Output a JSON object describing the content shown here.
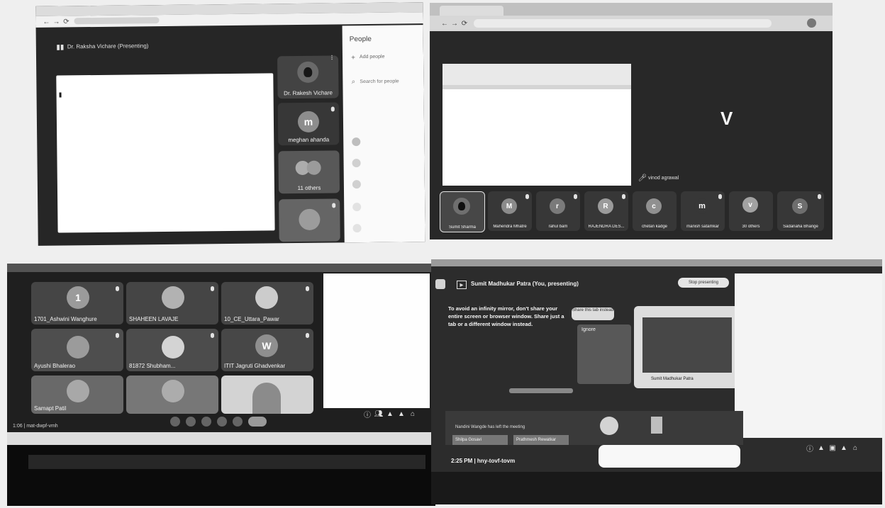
{
  "panel1": {
    "header_title": "Dr. Raksha Vichare (Presenting)",
    "presenter_name": "Dr. Rakesh Vichare",
    "participant_m_initial": "m",
    "participant_m_name": "meghan ahanda",
    "others_label": "11 others",
    "people_title": "People",
    "add_people_label": "Add people",
    "search_placeholder": "Search for people"
  },
  "panel2": {
    "large_tile_initial": "V",
    "large_tile_name": "vinod agrawal",
    "participants": [
      {
        "initial": "",
        "name": "Sumit Sharma"
      },
      {
        "initial": "M",
        "name": "Mahendra Mhatre"
      },
      {
        "initial": "r",
        "name": "rahul bam"
      },
      {
        "initial": "R",
        "name": "RAJENDRA DES..."
      },
      {
        "initial": "c",
        "name": "chetan kadge"
      },
      {
        "initial": "m",
        "name": "manish satamkar"
      },
      {
        "initial": "v",
        "name": "30 others"
      },
      {
        "initial": "S",
        "name": "Sadanaha Bhange"
      }
    ]
  },
  "panel3": {
    "tiles": [
      {
        "initial": "1",
        "name": "1701_Ashwini Wanghure"
      },
      {
        "initial": "",
        "name": "SHAHEEN LAVAJE"
      },
      {
        "initial": "",
        "name": "10_CE_Uttara_Pawar"
      },
      {
        "initial": "",
        "name": "Ayushi Bhalerao"
      },
      {
        "initial": "",
        "name": "81872 Shubham..."
      },
      {
        "initial": "W",
        "name": "ITIT Jagruti Ghadvenkar"
      },
      {
        "initial": "",
        "name": "Samapt Patil"
      },
      {
        "initial": "",
        "name": ""
      },
      {
        "initial": "",
        "name": ""
      }
    ],
    "meeting_code": "1:06 | mat-dwpf-vmh"
  },
  "panel4": {
    "presenting_label": "Sumit Madhukar Patra (You, presenting)",
    "stop_presenting": "Stop presenting",
    "warning_text": "To avoid an infinity mirror, don't share your entire screen or browser window. Share just a tab or a different window instead.",
    "ignore_label": "Ignore",
    "share_tab_label": "Share this tab instead",
    "preview_label": "Sumit Madhukar Patra",
    "raised_hand_text": "Nandini Wangde has left the meeting",
    "participant1": "Shilpa Gosavi",
    "participant2": "Prathmesh Rewatkar",
    "time_code": "2:25 PM | hny-tovf-tovm"
  }
}
